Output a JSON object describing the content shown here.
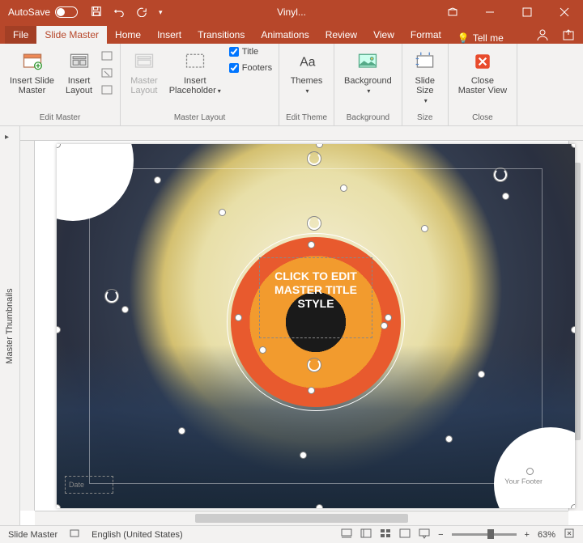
{
  "titlebar": {
    "autosave": "AutoSave",
    "title": "Vinyl..."
  },
  "tabs": {
    "file": "File",
    "slidemaster": "Slide Master",
    "home": "Home",
    "insert": "Insert",
    "transitions": "Transitions",
    "animations": "Animations",
    "review": "Review",
    "view": "View",
    "format": "Format",
    "tellme": "Tell me"
  },
  "ribbon": {
    "editmaster": {
      "label": "Edit Master",
      "insertslide": "Insert Slide\nMaster",
      "insertlayout": "Insert\nLayout"
    },
    "masterlayout": {
      "label": "Master Layout",
      "masterlayout": "Master\nLayout",
      "insertplaceholder": "Insert\nPlaceholder",
      "title": "Title",
      "footers": "Footers"
    },
    "edittheme": {
      "label": "Edit Theme",
      "themes": "Themes"
    },
    "background": {
      "label": "Background",
      "background": "Background"
    },
    "size": {
      "label": "Size",
      "slidesize": "Slide\nSize"
    },
    "close": {
      "label": "Close",
      "closemaster": "Close\nMaster View"
    }
  },
  "thumbnails": "Master Thumbnails",
  "slide": {
    "mastertitle": "CLICK TO EDIT MASTER TITLE STYLE",
    "date": "Date",
    "footer": "Your Footer"
  },
  "status": {
    "view": "Slide Master",
    "lang": "English (United States)",
    "zoom": "63%"
  }
}
